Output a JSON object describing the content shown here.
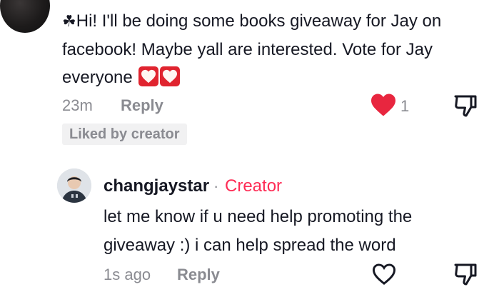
{
  "comment": {
    "prefix_icon": "☘",
    "text": "Hi! I'll be doing some books giveaway for Jay on facebook! Maybe yall are interested. Vote for Jay everyone",
    "emojis": [
      "heart-emoji",
      "heart-emoji"
    ],
    "time": "23m",
    "reply_label": "Reply",
    "like_count": "1",
    "liked_by_creator": "Liked by creator",
    "liked": true
  },
  "reply": {
    "username": "changjaystar",
    "separator": "·",
    "creator_label": "Creator",
    "text": "let me know if u need help promoting the giveaway :) i can help spread the word",
    "time": "1s ago",
    "reply_label": "Reply"
  },
  "colors": {
    "text": "#161823",
    "muted": "#8a8b91",
    "brand_red": "#fe2c55",
    "liked_heart": "#e8263f"
  }
}
